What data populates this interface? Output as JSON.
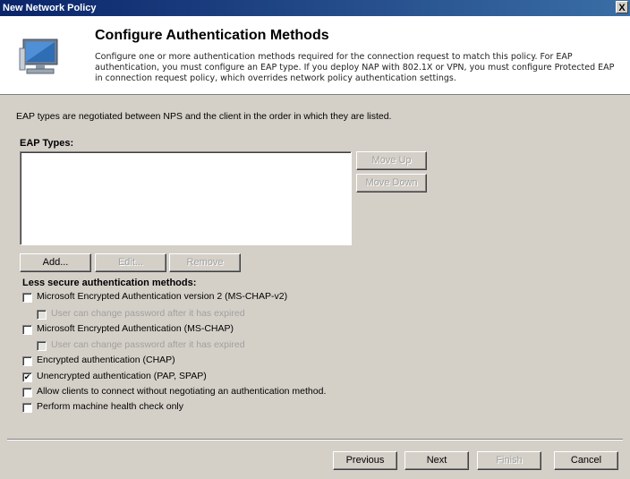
{
  "window": {
    "title": "New Network Policy",
    "close_glyph": "X"
  },
  "header": {
    "title": "Configure Authentication Methods",
    "description": "Configure one or more authentication methods required for the connection request to match this policy. For EAP authentication, you must configure an EAP type. If you deploy NAP with 802.1X or VPN, you must configure Protected EAP in connection request policy, which overrides network policy authentication settings.",
    "icon": "network-computer-icon"
  },
  "intro_text": "EAP types are negotiated between NPS and the client in the order in which they are listed.",
  "eap": {
    "label": "EAP Types:",
    "items": [],
    "move_up": "Move Up",
    "move_down": "Move Down",
    "add": "Add...",
    "edit": "Edit...",
    "remove": "Remove"
  },
  "less_secure": {
    "label": "Less secure authentication methods:",
    "options": [
      {
        "label": "Microsoft Encrypted Authentication version 2 (MS-CHAP-v2)",
        "checked": false,
        "enabled": true
      },
      {
        "label": "User can change password after it has expired",
        "checked": false,
        "enabled": false
      },
      {
        "label": "Microsoft Encrypted Authentication (MS-CHAP)",
        "checked": false,
        "enabled": true
      },
      {
        "label": "User can change password after it has expired",
        "checked": false,
        "enabled": false
      },
      {
        "label": "Encrypted authentication (CHAP)",
        "checked": false,
        "enabled": true
      },
      {
        "label": "Unencrypted authentication (PAP, SPAP)",
        "checked": true,
        "enabled": true
      },
      {
        "label": "Allow clients to connect without negotiating an authentication method.",
        "checked": false,
        "enabled": true
      },
      {
        "label": "Perform machine health check only",
        "checked": false,
        "enabled": true
      }
    ]
  },
  "footer": {
    "previous": "Previous",
    "next": "Next",
    "finish": "Finish",
    "cancel": "Cancel"
  },
  "colors": {
    "dialog_bg": "#d4d0c8",
    "title_bar": "#0a246a",
    "header_bg": "#ffffff"
  }
}
